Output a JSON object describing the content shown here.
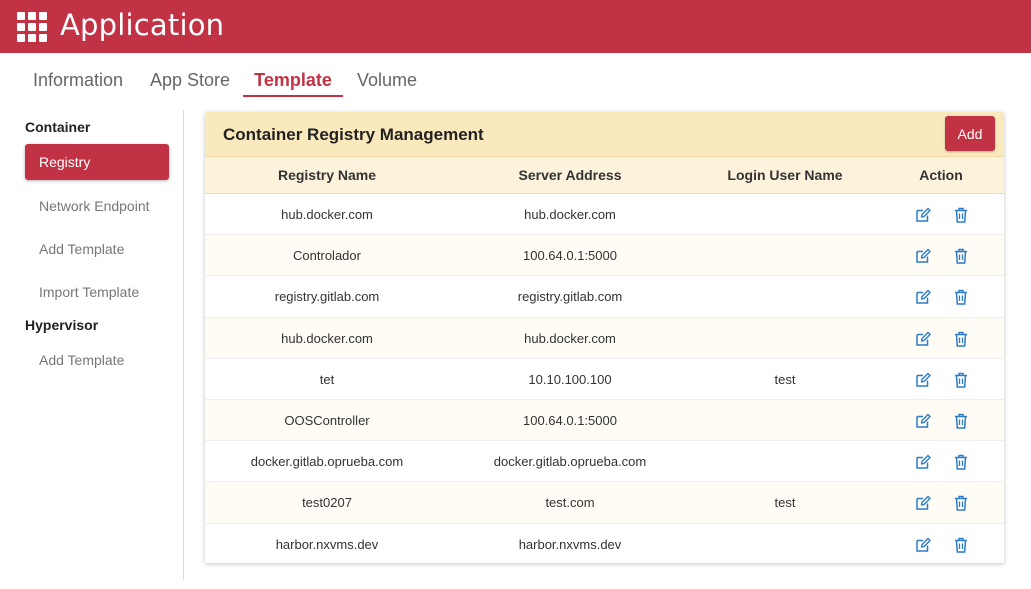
{
  "app": {
    "title": "Application",
    "grid_icon": "apps-grid-icon",
    "brand_color": "#c13244"
  },
  "tabs": [
    {
      "label": "Information",
      "active": false
    },
    {
      "label": "App Store",
      "active": false
    },
    {
      "label": "Template",
      "active": true
    },
    {
      "label": "Volume",
      "active": false
    }
  ],
  "sidebar": {
    "groups": [
      {
        "label": "Container",
        "items": [
          "Registry",
          "Network Endpoint",
          "Add Template",
          "Import Template"
        ],
        "active": "Registry"
      },
      {
        "label": "Hypervisor",
        "items": [
          "Add Template"
        ]
      }
    ]
  },
  "card": {
    "title": "Container Registry Management",
    "add_label": "Add",
    "header_bg": "#fbe9be"
  },
  "table": {
    "columns": [
      "Registry Name",
      "Server Address",
      "Login User Name",
      "Action"
    ],
    "rows": [
      {
        "name": "hub.docker.com",
        "address": "hub.docker.com",
        "user": ""
      },
      {
        "name": "Controlador",
        "address": "100.64.0.1:5000",
        "user": ""
      },
      {
        "name": "registry.gitlab.com",
        "address": "registry.gitlab.com",
        "user": ""
      },
      {
        "name": "hub.docker.com",
        "address": "hub.docker.com",
        "user": ""
      },
      {
        "name": "tet",
        "address": "10.10.100.100",
        "user": "test"
      },
      {
        "name": "OOSController",
        "address": "100.64.0.1:5000",
        "user": ""
      },
      {
        "name": "docker.gitlab.oprueba.com",
        "address": "docker.gitlab.oprueba.com",
        "user": ""
      },
      {
        "name": "test0207",
        "address": "test.com",
        "user": "test"
      },
      {
        "name": "harbor.nxvms.dev",
        "address": "harbor.nxvms.dev",
        "user": ""
      }
    ],
    "action_icons": [
      "edit-icon",
      "trash-icon"
    ],
    "action_color": "#2c7cc8"
  }
}
